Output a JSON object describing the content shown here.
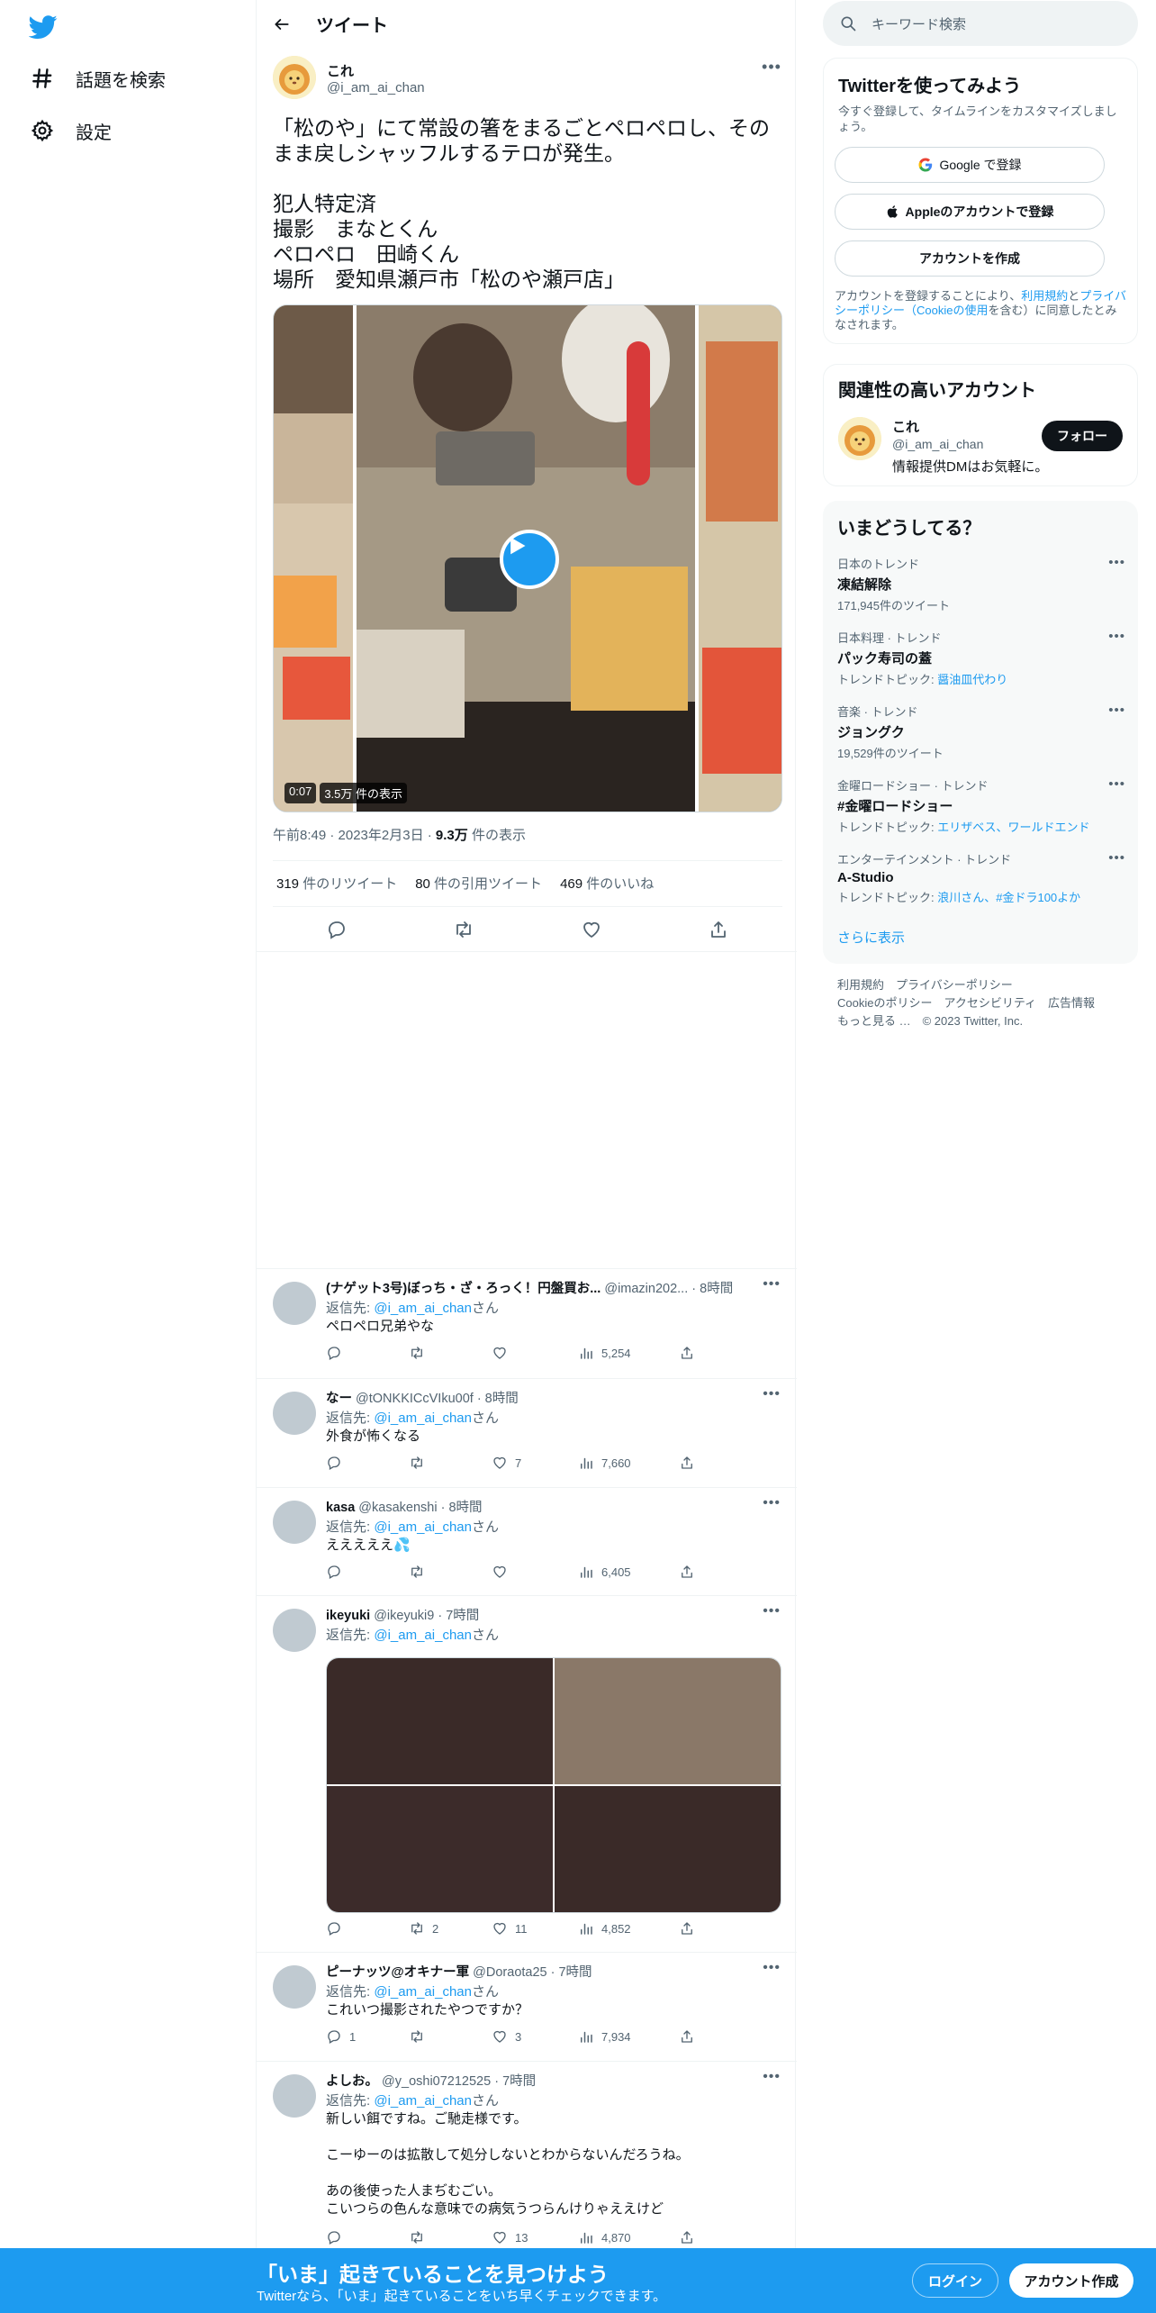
{
  "colors": {
    "accent": "#1d9bf0",
    "text": "#0f1419",
    "muted": "#536471",
    "border": "#eff3f4",
    "dark_button": "#0f1419"
  },
  "nav": {
    "logo": "twitter-bird-icon",
    "items": [
      {
        "label": "話題を検索",
        "icon": "hash-icon"
      },
      {
        "label": "設定",
        "icon": "gear-icon"
      }
    ]
  },
  "header": {
    "title": "ツイート"
  },
  "tweet": {
    "author_name": "これ",
    "author_handle": "@i_am_ai_chan",
    "text": "「松のや」にて常設の箸をまるごとペロペロし、そのまま戻しシャッフルするテロが発生。\n\n犯人特定済\n撮影　まなとくん\nペロペロ　田崎くん\n場所　愛知県瀬戸市「松のや瀬戸店」",
    "video_time": "0:07",
    "video_views": "3.5万 件の表示",
    "timestamp": "午前8:49 · 2023年2月3日 · ",
    "views_count": "9.3万",
    "views_label": " 件の表示",
    "retweets_count": "319",
    "retweets_label": " 件のリツイート",
    "quotes_count": "80",
    "quotes_label": " 件の引用ツイート",
    "likes_count": "469",
    "likes_label": " 件のいいね"
  },
  "replies": [
    {
      "name": "(ナゲット3号)ぼっち・ざ・ろっく！円盤買お...",
      "handle": "@imazin202...",
      "time": "· 8時間",
      "reply_to_prefix": "返信先: ",
      "reply_to": "@i_am_ai_chan",
      "reply_to_suffix": "さん",
      "body": "ペロペロ兄弟やな",
      "reply_count": "",
      "rt_count": "",
      "like_count": "",
      "views": "5,254"
    },
    {
      "name": "なー",
      "handle": "@tONKKICcVIku00f",
      "time": "· 8時間",
      "reply_to_prefix": "返信先: ",
      "reply_to": "@i_am_ai_chan",
      "reply_to_suffix": "さん",
      "body": "外食が怖くなる",
      "reply_count": "",
      "rt_count": "",
      "like_count": "7",
      "views": "7,660"
    },
    {
      "name": "kasa",
      "handle": "@kasakenshi",
      "time": "· 8時間",
      "reply_to_prefix": "返信先: ",
      "reply_to": "@i_am_ai_chan",
      "reply_to_suffix": "さん",
      "body": "えええええ💦",
      "reply_count": "",
      "rt_count": "",
      "like_count": "",
      "views": "6,405"
    },
    {
      "name": "ikeyuki",
      "handle": "@ikeyuki9",
      "time": "· 7時間",
      "reply_to_prefix": "返信先: ",
      "reply_to": "@i_am_ai_chan",
      "reply_to_suffix": "さん",
      "body": "",
      "reply_count": "",
      "rt_count": "2",
      "like_count": "11",
      "views": "4,852"
    },
    {
      "name": "ピーナッツ@オキナー軍",
      "handle": "@Doraota25",
      "time": "· 7時間",
      "reply_to_prefix": "返信先: ",
      "reply_to": "@i_am_ai_chan",
      "reply_to_suffix": "さん",
      "body": "これいつ撮影されたやつですか？",
      "reply_count": "1",
      "rt_count": "",
      "like_count": "3",
      "views": "7,934"
    },
    {
      "name": "よしお。",
      "handle": "@y_oshi07212525",
      "time": "· 7時間",
      "reply_to_prefix": "返信先: ",
      "reply_to": "@i_am_ai_chan",
      "reply_to_suffix": "さん",
      "body": "新しい餌ですね。ご馳走様です。\n\nこーゆーのは拡散して処分しないとわからないんだろうね。\n\nあの後使った人まぢむごい。\nこいつらの色んな意味での病気うつらんけりゃええけど",
      "reply_count": "",
      "rt_count": "",
      "like_count": "13",
      "views": "4,870"
    }
  ],
  "right": {
    "search_placeholder": "キーワード検索",
    "signup": {
      "title": "Twitterを使ってみよう",
      "subtitle": "今すぐ登録して、タイムラインをカスタマイズしましょう。",
      "google": "Google で登録",
      "apple": "Appleのアカウントで登録",
      "create": "アカウントを作成",
      "terms_1": "アカウントを登録することにより、",
      "terms_link1": "利用規約",
      "terms_2": "と",
      "terms_link2": "プライバシーポリシー（Cookieの使用",
      "terms_3": "を含む）に同意したとみなされます。"
    },
    "related": {
      "title": "関連性の高いアカウント",
      "name": "これ",
      "handle": "@i_am_ai_chan",
      "bio": "情報提供DMはお気軽に。",
      "follow": "フォロー"
    },
    "trends": {
      "title": "いまどうしてる？",
      "items": [
        {
          "category": "日本のトレンド",
          "name": "凍結解除",
          "count": "171,945件のツイート",
          "topic_prefix": "",
          "topics": ""
        },
        {
          "category": "日本料理 · トレンド",
          "name": "パック寿司の蓋",
          "count": "",
          "topic_prefix": "トレンドトピック: ",
          "topics": "醤油皿代わり"
        },
        {
          "category": "音楽 · トレンド",
          "name": "ジョングク",
          "count": "19,529件のツイート",
          "topic_prefix": "",
          "topics": ""
        },
        {
          "category": "金曜ロードショー · トレンド",
          "name": "#金曜ロードショー",
          "count": "",
          "topic_prefix": "トレンドトピック: ",
          "topics": "エリザベス、ワールドエンド"
        },
        {
          "category": "エンターテインメント · トレンド",
          "name": "A-Studio",
          "count": "",
          "topic_prefix": "トレンドトピック: ",
          "topics": "浪川さん、#金ドラ100よか"
        }
      ],
      "show_more": "さらに表示"
    },
    "footer": {
      "line1": "利用規約　プライバシーポリシー",
      "line2": "Cookieのポリシー　アクセシビリティ　広告情報",
      "line3": "もっと見る …　© 2023 Twitter, Inc."
    }
  },
  "bottom_banner": {
    "headline": "「いま」起きていることを見つけよう",
    "sub": "Twitterなら、「いま」起きていることをいち早くチェックできます。",
    "login": "ログイン",
    "signup": "アカウント作成"
  }
}
